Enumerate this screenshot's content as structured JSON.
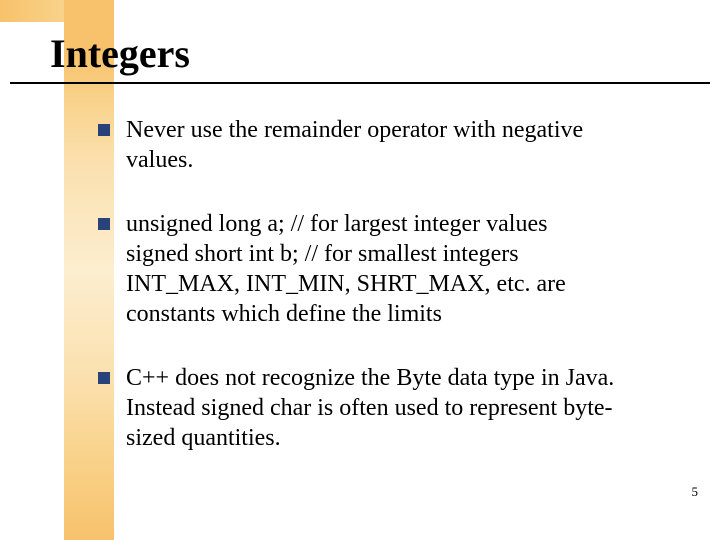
{
  "title": "Integers",
  "bullets": [
    {
      "lines": [
        "Never use the remainder operator with negative",
        "values."
      ]
    },
    {
      "lines": [
        "unsigned long a; // for largest integer values",
        "signed short int b; // for smallest integers",
        "INT_MAX, INT_MIN, SHRT_MAX, etc. are",
        "constants which define the limits"
      ]
    },
    {
      "lines": [
        "C++ does not recognize the Byte data type in Java.",
        "Instead signed char is often used to represent byte-",
        "sized quantities."
      ]
    }
  ],
  "page_number": "5"
}
